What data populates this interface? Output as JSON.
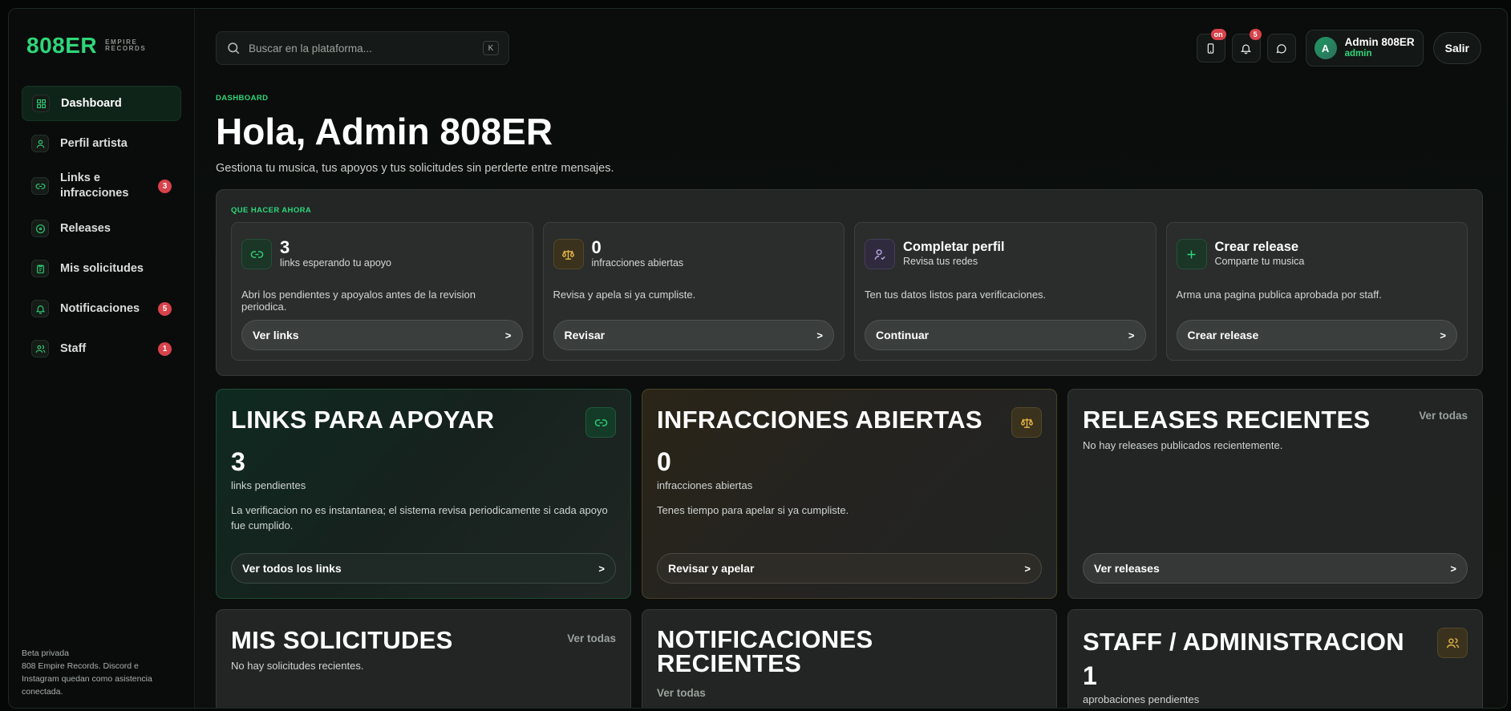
{
  "brand": {
    "logo": "808ER",
    "sub_line1": "EMPIRE",
    "sub_line2": "RECORDS"
  },
  "sidebar": {
    "items": [
      {
        "label": "Dashboard",
        "icon": "grid-icon",
        "active": true,
        "badge": ""
      },
      {
        "label": "Perfil artista",
        "icon": "user-icon",
        "badge": ""
      },
      {
        "label": "Links e infracciones",
        "icon": "link-icon",
        "badge": "3"
      },
      {
        "label": "Releases",
        "icon": "disc-icon",
        "badge": ""
      },
      {
        "label": "Mis solicitudes",
        "icon": "clipboard-icon",
        "badge": ""
      },
      {
        "label": "Notificaciones",
        "icon": "bell-icon",
        "badge": "5"
      },
      {
        "label": "Staff",
        "icon": "users-icon",
        "badge": "1"
      }
    ],
    "footer_title": "Beta privada",
    "footer_text": "808 Empire Records. Discord e Instagram quedan como asistencia conectada."
  },
  "topbar": {
    "search_placeholder": "Buscar en la plataforma...",
    "search_shortcut": "K",
    "mobile_badge": "on",
    "notifications_badge": "5",
    "user": {
      "initial": "A",
      "name": "Admin 808ER",
      "role": "admin"
    },
    "logout_label": "Salir"
  },
  "header": {
    "eyebrow": "DASHBOARD",
    "title": "Hola, Admin 808ER",
    "subtitle": "Gestiona tu musica, tus apoyos y tus solicitudes sin perderte entre mensajes."
  },
  "next_steps": {
    "eyebrow": "QUE HACER AHORA",
    "items": [
      {
        "num": "3",
        "caption": "links esperando tu apoyo",
        "desc": "Abri los pendientes y apoyalos antes de la revision periodica.",
        "button": "Ver links",
        "icon": "link-icon"
      },
      {
        "num": "0",
        "caption": "infracciones abiertas",
        "desc": "Revisa y apela si ya cumpliste.",
        "button": "Revisar",
        "icon": "scale-icon"
      },
      {
        "title": "Completar perfil",
        "caption": "Revisa tus redes",
        "desc": "Ten tus datos listos para verificaciones.",
        "button": "Continuar",
        "icon": "user-check-icon"
      },
      {
        "title": "Crear release",
        "caption": "Comparte tu musica",
        "desc": "Arma una pagina publica aprobada por staff.",
        "button": "Crear release",
        "icon": "plus-icon"
      }
    ]
  },
  "cards": {
    "links": {
      "title": "LINKS PARA APOYAR",
      "num": "3",
      "num_label": "links pendientes",
      "desc": "La verificacion no es instantanea; el sistema revisa periodicamente si cada apoyo fue cumplido.",
      "button": "Ver todos los links"
    },
    "infractions": {
      "title": "INFRACCIONES ABIERTAS",
      "num": "0",
      "num_label": "infracciones abiertas",
      "desc": "Tenes tiempo para apelar si ya cumpliste.",
      "button": "Revisar y apelar"
    },
    "releases": {
      "title": "RELEASES RECIENTES",
      "see_all": "Ver todas",
      "empty": "No hay releases publicados recientemente.",
      "button": "Ver releases"
    },
    "requests": {
      "title": "MIS SOLICITUDES",
      "see_all": "Ver todas",
      "empty": "No hay solicitudes recientes."
    },
    "notifications": {
      "title_line1": "NOTIFICACIONES",
      "title_line2": "RECIENTES",
      "see_all": "Ver todas"
    },
    "staff": {
      "title": "STAFF / ADMINISTRACION",
      "num": "1",
      "num_label": "aprobaciones pendientes"
    }
  },
  "arrow": ">",
  "colors": {
    "accent": "#2fd67a",
    "badge": "#d8424a",
    "amber": "#e3b347",
    "purple": "#b9a7e6"
  }
}
